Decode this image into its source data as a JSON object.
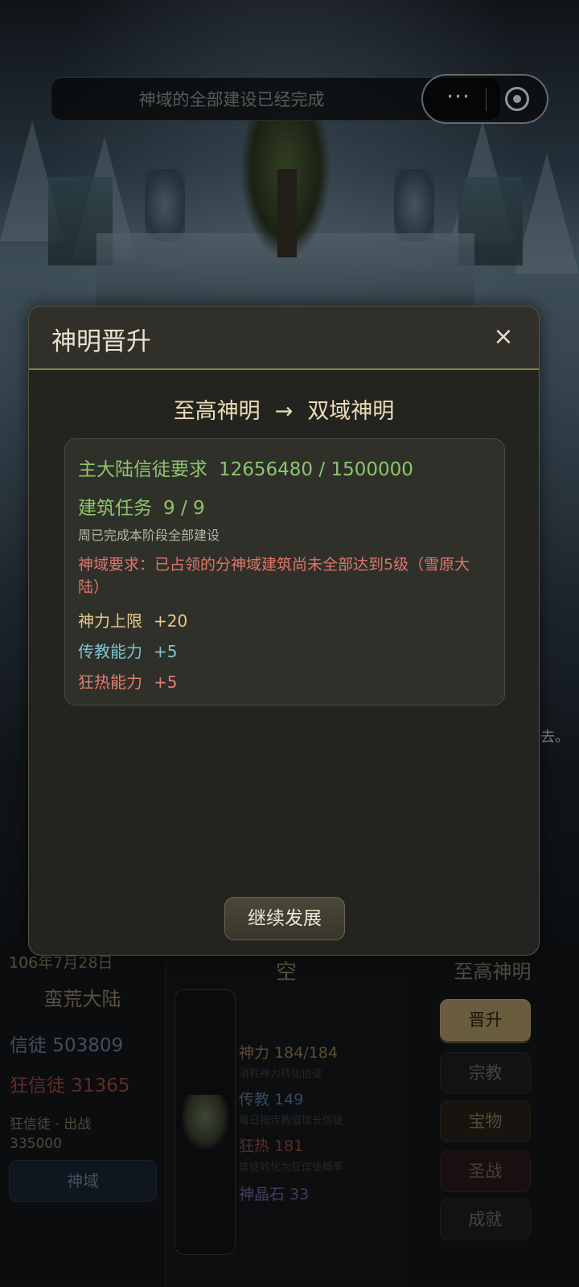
{
  "top_banner": {
    "text": "神域的全部建设已经完成"
  },
  "capsule": {
    "more_icon": "⋯",
    "target_icon": "record-icon"
  },
  "scene": {
    "side_text": "去。"
  },
  "bottom": {
    "left": {
      "date": "106年7月28日",
      "continent": "蛮荒大陆",
      "believers": "信徒 503809",
      "fanatics": "狂信徒 31365",
      "fanatics_battle_label": "狂信徒 · 出战",
      "fanatics_battle_value": "335000",
      "realm_button": "神域"
    },
    "middle": {
      "title": "空",
      "stats": [
        {
          "label": "神力 184/184",
          "desc": "消耗神力转化信徒"
        },
        {
          "label": "传教 149",
          "desc": "每日按传教值增长信徒"
        },
        {
          "label": "狂热 181",
          "desc": "信徒转化为狂信徒概率"
        },
        {
          "label": "神晶石 33",
          "desc": ""
        }
      ]
    },
    "right": {
      "rank": "至高神明",
      "buttons": [
        "晋升",
        "宗教",
        "宝物",
        "圣战",
        "成就"
      ]
    }
  },
  "modal": {
    "title": "神明晋升",
    "close_icon": "×",
    "from_rank": "至高神明",
    "arrow": "→",
    "to_rank": "双域神明",
    "believer_req_label": "主大陆信徒要求",
    "believer_req_value": "12656480 / 1500000",
    "build_task_label": "建筑任务",
    "build_task_value": "9 / 9",
    "build_note": "周已完成本阶段全部建设",
    "realm_req": "神域要求：已占领的分神域建筑尚未全部达到5级（雪原大陆）",
    "rewards": [
      {
        "label": "神力上限",
        "value": "+20"
      },
      {
        "label": "传教能力",
        "value": "+5"
      },
      {
        "label": "狂热能力",
        "value": "+5"
      }
    ],
    "continue_button": "继续发展"
  },
  "colors": {
    "modal_bg": "#23241f",
    "accent_gold": "#e8c98a",
    "requirement_green": "#8fc46e",
    "warning_red": "#e0756a",
    "ability_teal": "#7cc4cf"
  }
}
